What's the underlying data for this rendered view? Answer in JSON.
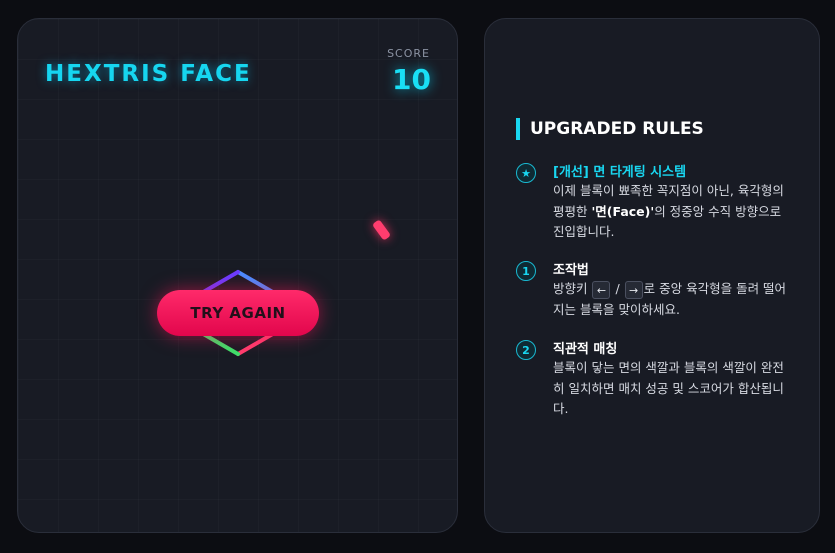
{
  "game": {
    "title": "HEXTRIS FACE",
    "score_label": "SCORE",
    "score_value": "10",
    "try_again_label": "TRY AGAIN",
    "hexagon_face_colors": [
      "#4a8cff",
      "#ff8a2e",
      "#ff3d6e",
      "#3ee06a",
      "#3ee06a",
      "#6a3cff"
    ],
    "falling_block_color": "#ff3d6e"
  },
  "rules": {
    "heading": "UPGRADED RULES",
    "items": [
      {
        "badge": "★",
        "title": "[개선] 면 타게팅 시스템",
        "body_before": "이제 블록이 뾰족한 꼭지점이 아닌, 육각형의 평평한 ",
        "body_bold": "'면(Face)'",
        "body_after": "의 정중앙 수직 방향으로 진입합니다."
      },
      {
        "badge": "1",
        "title": "조작법",
        "body_before": "방향키 ",
        "key_left": "←",
        "separator": " / ",
        "key_right": "→",
        "body_after": "로 중앙 육각형을 돌려 떨어지는 블록을 맞이하세요."
      },
      {
        "badge": "2",
        "title": "직관적 매칭",
        "body": "블록이 닿는 면의 색깔과 블록의 색깔이 완전히 일치하면 매치 성공 및 스코어가 합산됩니다."
      }
    ]
  },
  "colors": {
    "accent": "#19d6f0",
    "background": "#0c0d12",
    "panel": "#181b24",
    "button": "#ff2a6a"
  }
}
